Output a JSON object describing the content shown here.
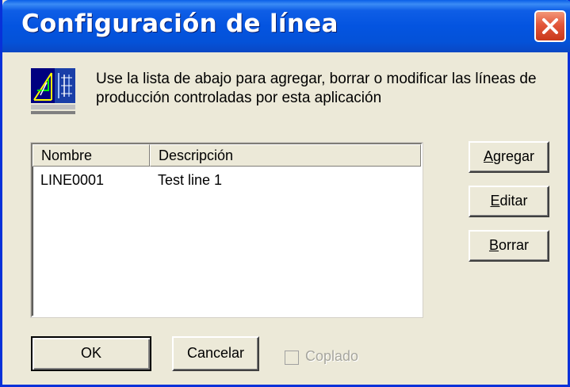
{
  "window": {
    "title": "Configuración de línea"
  },
  "dialog": {
    "instructions": "Use la lista de abajo para agregar, borrar o modificar las líneas de producción controladas por esta aplicación"
  },
  "list": {
    "columns": [
      "Nombre",
      "Descripción"
    ],
    "rows": [
      {
        "name": "LINE0001",
        "description": "Test line 1"
      }
    ]
  },
  "buttons": {
    "add": {
      "pre": "",
      "accel": "A",
      "post": "gregar"
    },
    "edit": {
      "pre": "",
      "accel": "E",
      "post": "ditar"
    },
    "delete": {
      "pre": "",
      "accel": "B",
      "post": "orrar"
    },
    "ok": "OK",
    "cancel": "Cancelar"
  },
  "options": {
    "coupled_label": "Coplado",
    "coupled_checked": false,
    "coupled_enabled": false
  },
  "icons": {
    "close": "close-icon",
    "app": "production-line-icon"
  },
  "colors": {
    "titlebar": "#0454e0",
    "close_button": "#e2563a",
    "dialog_bg": "#ece9d8",
    "disabled_text": "#a7a69e"
  }
}
